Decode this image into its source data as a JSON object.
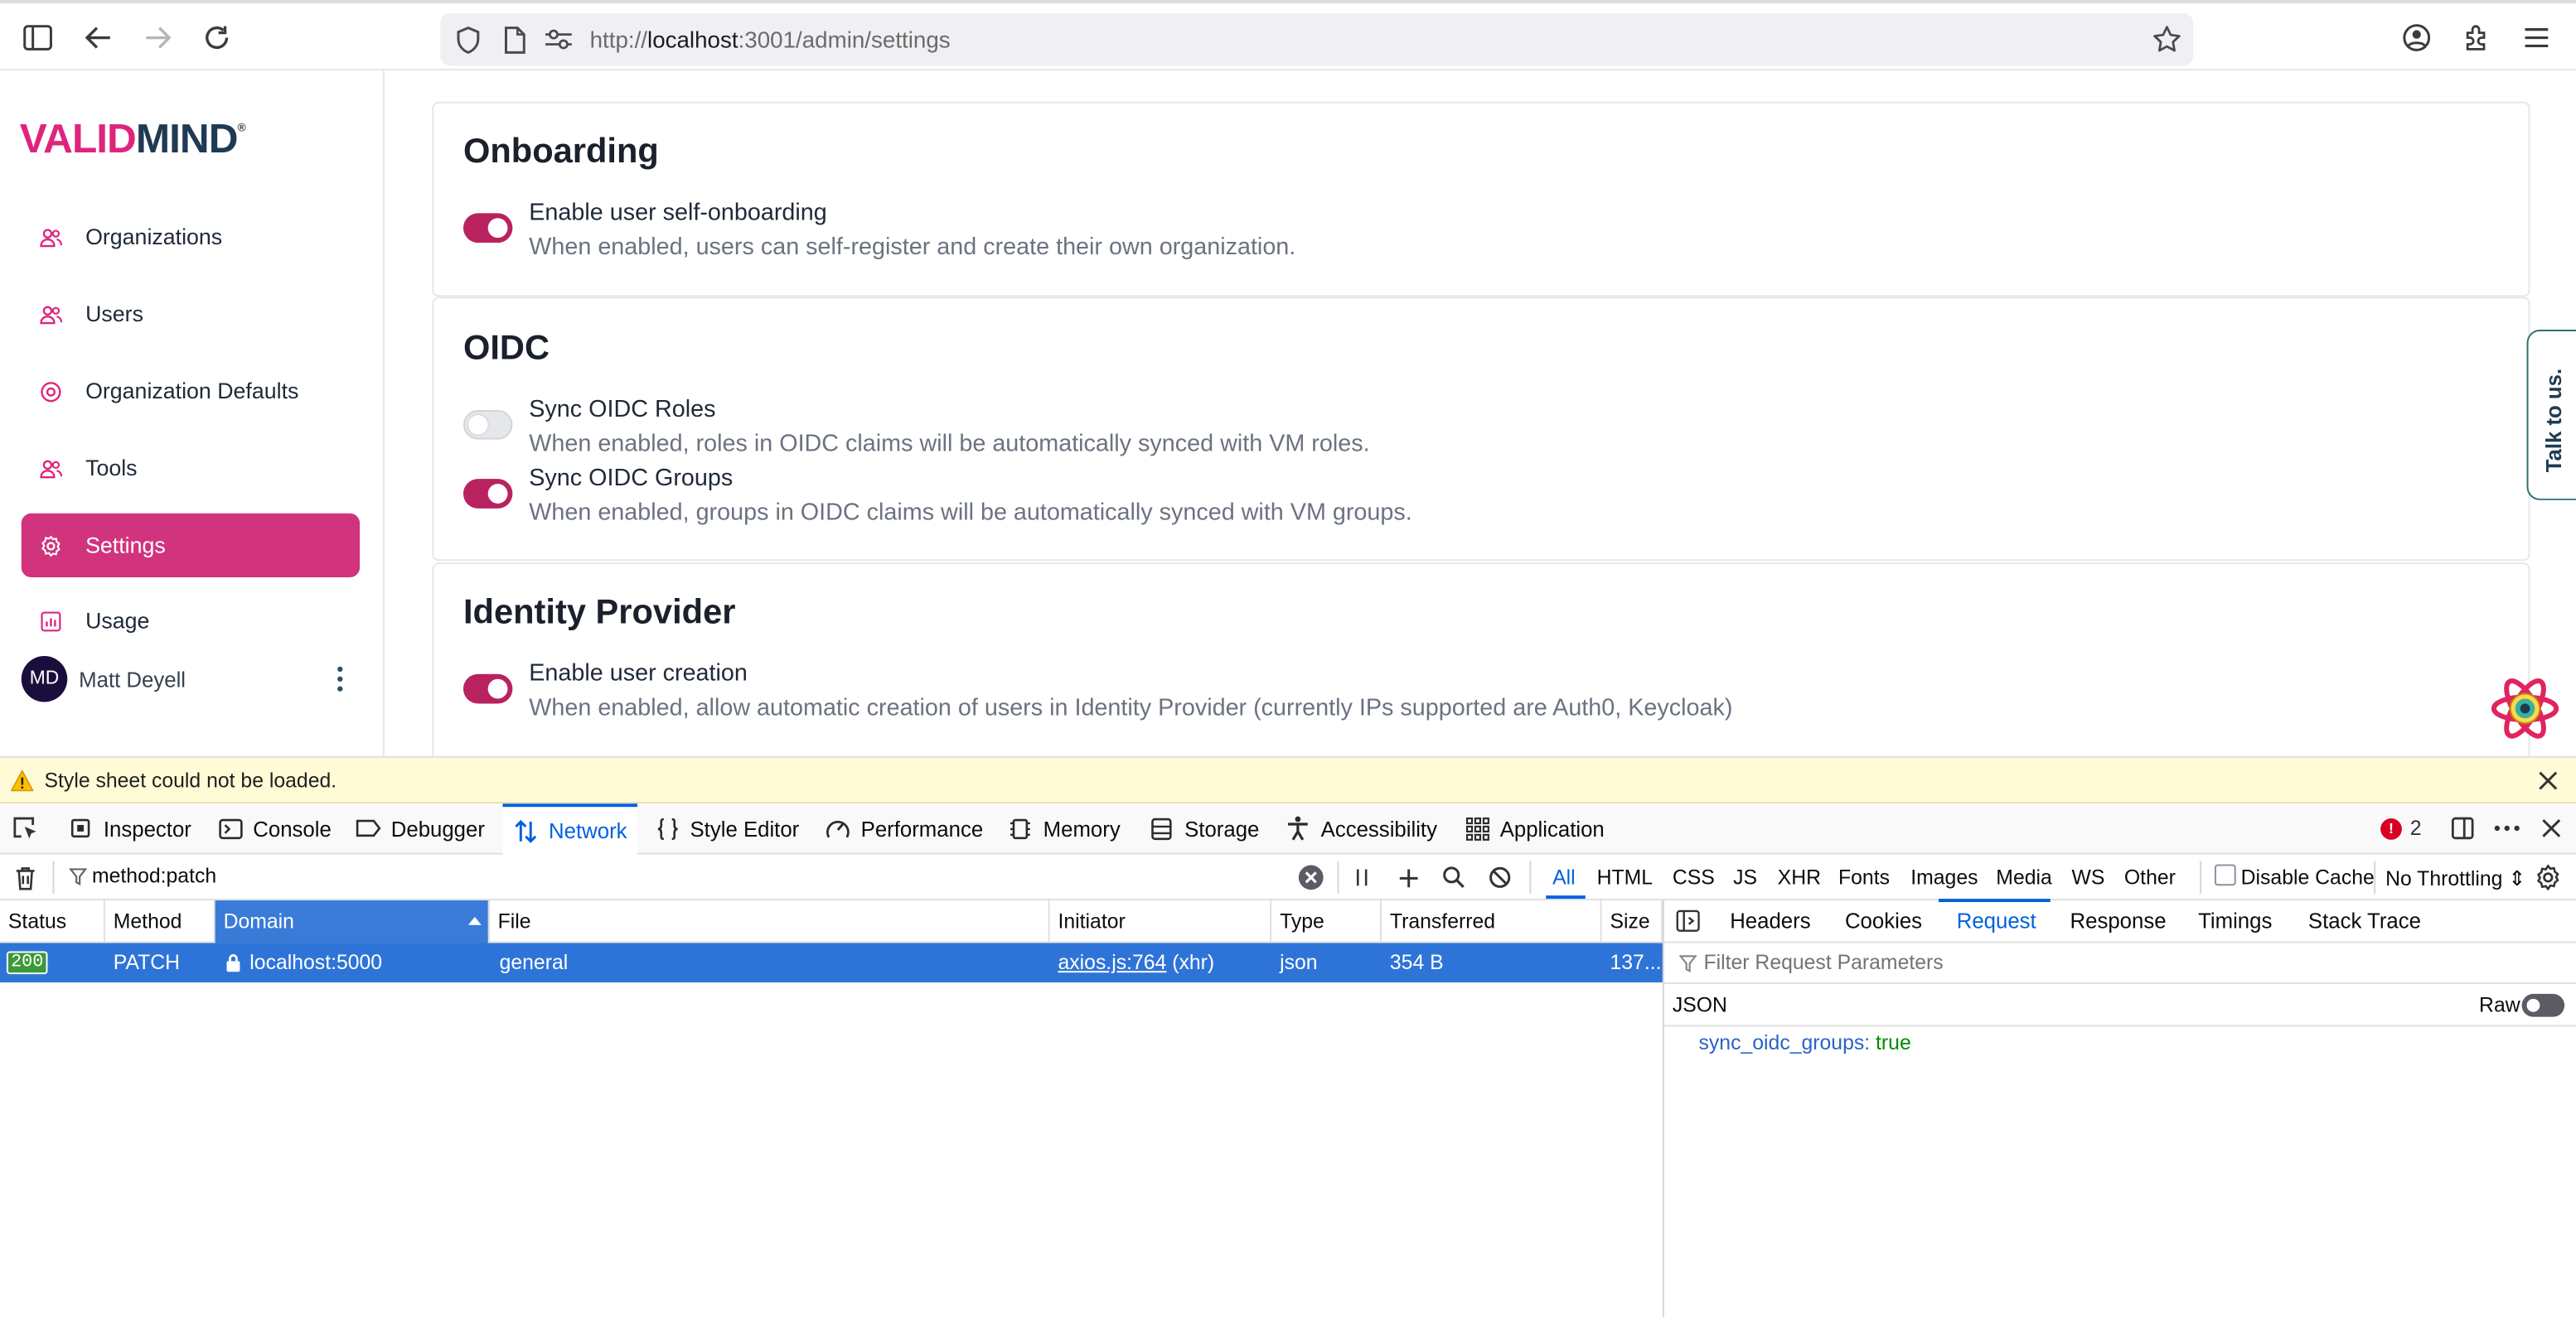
{
  "browser": {
    "url_prefix": "http://",
    "url_host": "localhost",
    "url_rest": ":3001/admin/settings"
  },
  "app": {
    "logo": {
      "part1": "VALID",
      "part2": "MIND",
      "reg": "®"
    },
    "nav": [
      {
        "label": "Organizations",
        "icon": "users-icon"
      },
      {
        "label": "Users",
        "icon": "users-icon"
      },
      {
        "label": "Organization Defaults",
        "icon": "target-icon"
      },
      {
        "label": "Tools",
        "icon": "users-icon"
      },
      {
        "label": "Settings",
        "icon": "gear-icon",
        "active": true
      },
      {
        "label": "Usage",
        "icon": "chart-icon"
      }
    ],
    "user": {
      "initials": "MD",
      "name": "Matt Deyell"
    },
    "accent_color": "#d1347d",
    "sections": {
      "onboarding": {
        "title": "Onboarding",
        "items": [
          {
            "label": "Enable user self-onboarding",
            "desc": "When enabled, users can self-register and create their own organization.",
            "enabled": true
          }
        ]
      },
      "oidc": {
        "title": "OIDC",
        "items": [
          {
            "label": "Sync OIDC Roles",
            "desc": "When enabled, roles in OIDC claims will be automatically synced with VM roles.",
            "enabled": false
          },
          {
            "label": "Sync OIDC Groups",
            "desc": "When enabled, groups in OIDC claims will be automatically synced with VM groups.",
            "enabled": true
          }
        ]
      },
      "idp": {
        "title": "Identity Provider",
        "items": [
          {
            "label": "Enable user creation",
            "desc": "When enabled, allow automatic creation of users in Identity Provider (currently IPs supported are Auth0, Keycloak)",
            "enabled": true
          }
        ]
      }
    },
    "talk_label": "Talk to us."
  },
  "devtools": {
    "warning": "Style sheet could not be loaded.",
    "tabs": [
      "Inspector",
      "Console",
      "Debugger",
      "Network",
      "Style Editor",
      "Performance",
      "Memory",
      "Storage",
      "Accessibility",
      "Application"
    ],
    "selected_tab": "Network",
    "error_count": "2",
    "filter_value": "method:patch",
    "type_filters": [
      "All",
      "HTML",
      "CSS",
      "JS",
      "XHR",
      "Fonts",
      "Images",
      "Media",
      "WS",
      "Other"
    ],
    "selected_type": "All",
    "disable_cache_label": "Disable Cache",
    "throttling": "No Throttling",
    "columns": [
      "Status",
      "Method",
      "Domain",
      "File",
      "Initiator",
      "Type",
      "Transferred",
      "Size"
    ],
    "row": {
      "status": "200",
      "method": "PATCH",
      "domain": "localhost:5000",
      "file": "general",
      "initiator_link": "axios.js:764",
      "initiator_kind": "(xhr)",
      "type": "json",
      "transferred": "354 B",
      "size": "137..."
    },
    "detail_tabs": [
      "Headers",
      "Cookies",
      "Request",
      "Response",
      "Timings",
      "Stack Trace"
    ],
    "selected_detail_tab": "Request",
    "filter_params_placeholder": "Filter Request Parameters",
    "json_label": "JSON",
    "raw_label": "Raw",
    "json_key": "sync_oidc_groups",
    "json_value": "true"
  }
}
